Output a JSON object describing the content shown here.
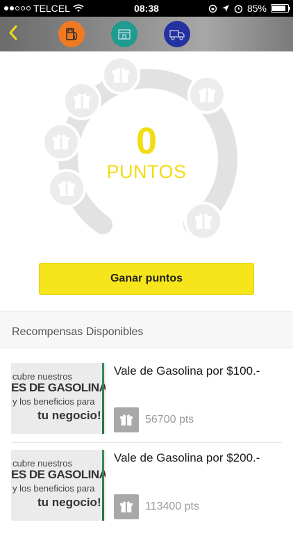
{
  "status_bar": {
    "carrier": "TELCEL",
    "time": "08:38",
    "battery": "85%",
    "battery_level": 0.85,
    "signal_bars": 2
  },
  "nav": {
    "icons": [
      {
        "name": "pump-icon",
        "color": "#f07a22"
      },
      {
        "name": "store-icon",
        "color": "#1f9b8f"
      },
      {
        "name": "truck-icon",
        "color": "#2332a0"
      }
    ]
  },
  "points": {
    "value": "0",
    "label": "PUNTOS"
  },
  "earn_button": "Ganar puntos",
  "rewards_title": "Recompensas Disponibles",
  "rewards": [
    {
      "title": "Vale de Gasolina por $100.-",
      "points": "56700 pts",
      "image_text": [
        "cubre nuestros",
        "ES DE GASOLINA",
        "y los beneficios para",
        "tu negocio!"
      ]
    },
    {
      "title": "Vale de Gasolina por $200.-",
      "points": "113400 pts",
      "image_text": [
        "cubre nuestros",
        "ES DE GASOLINA",
        "y los beneficios para",
        "tu negocio!"
      ]
    }
  ],
  "colors": {
    "accent": "#f2dc13",
    "button": "#f6e51b",
    "ring": "#e2e2e2"
  }
}
